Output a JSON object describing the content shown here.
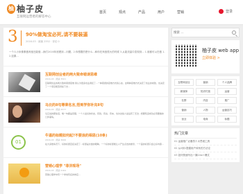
{
  "site": {
    "logo_mark": "柚",
    "name": "柚子皮",
    "tagline": "互联网运营者的解答中心"
  },
  "nav": {
    "items": [
      "首页",
      "观点",
      "产品",
      "用户",
      "营销"
    ],
    "login": "登录"
  },
  "featured": {
    "number": "3",
    "title": "90%做淘宝必死,请不要装逼",
    "meta": "2016-03  ·  阅读 2352  ·  评论 0",
    "summary": "一个人小米像素做淘宝还能做...我们2016年底看到...问题，2.你想要的是什么...和你在淘宝很大的时候 3.从能流量中变现到... 1.谁都可以在做 1. 2.如果..."
  },
  "articles": [
    {
      "title": "互联网创业者的两大致命错误思维",
      "meta": "2016-03  ·  阅读 3501",
      "excerpt": "互联网创业的两大致命错误思维 我认为很多创业者犯了...一种错误的思维方式和心态，这两种思维方式决定了创业的成败，也决定了一个项目能否持续下去...",
      "thumb": "thumb-1"
    },
    {
      "title": "马云的8句尊荣名言,悟到学你补充8句",
      "meta": "2016-03  ·  阅读 2577",
      "excerpt": "马云说的那些话，每一句都是真理，一个人最好的状态，有钱、有房、有车，也许这些人最后有了无法...想要知道成功必须要做的几件事情。",
      "thumb": "thumb-2"
    },
    {
      "title": "牛逼的标题如何起?不要浪的相思(10条)",
      "meta": "2016-03  ·  阅读 3006",
      "excerpt": "在大多数情况下，好的标题直接决定了...标题是文章的眼睛，一个好的标题能让人产生点击的欲望，一个差的标题只会让好内容...",
      "thumb": "thumb-3",
      "thumb_label": "01"
    },
    {
      "title": "营销心理学 \"菲洪现场\"",
      "meta": "2016-03  ·  阅读 2164",
      "excerpt": "营销心理学中有一个非常有名的效应...",
      "thumb": "thumb-4"
    }
  ],
  "sidebar": {
    "search_placeholder": "搜索 ...",
    "app": {
      "name": "柚子皮 web app",
      "link": "立即体验 >"
    },
    "tags_1": [
      "互联网创业",
      "营销",
      "个人品牌",
      "新媒体",
      "知识付费",
      "运营",
      "社群",
      "内容",
      "推广"
    ],
    "tags_2": [
      "营销",
      "人物",
      "运营技巧",
      "创业",
      "电商",
      "标题"
    ],
    "news_head": "热门文章",
    "news": [
      "01  运营推广必备的十大思维工具",
      "02  从0到1搭建用户体系的方法论",
      "03  如何快速写出一篇10w+爆文"
    ]
  }
}
